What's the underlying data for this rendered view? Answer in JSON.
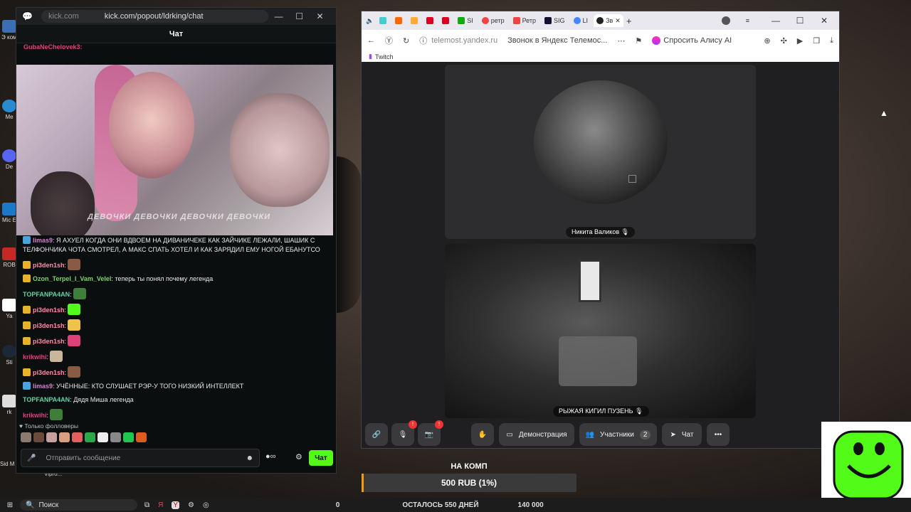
{
  "desktop": {
    "icons": [
      "Э комп",
      "Me",
      "De",
      "Mic E",
      "ROB",
      "Ya",
      "Sti",
      "rk",
      "Sid M Civilization VI"
    ],
    "taskbar_label": "Vipro..."
  },
  "kick_window": {
    "url_host": "kick.com",
    "url_path": "kick.com/popout/ldrking/chat",
    "chat_title": "Чат",
    "pinned_user": "GubaNeChelovek3:",
    "video_caption": "ДЕВОЧКИ ДЕВОЧКИ ДЕВОЧКИ ДЕВОЧКИ",
    "messages": [
      {
        "user": "limas9",
        "text": ": Я АХУЕЛ КОГДА ОНИ ВДВОЕМ НА ДИВАНИЧЕКЕ КАК ЗАЙЧИКЕ ЛЕЖАЛИ, ШАШИК С ТЕЛФОНЧИКА ЧОТА СМОТРЕЛ, А МАКС СПАТЬ ХОТЕЛ И КАК ЗАРЯДИЛ ЕМУ НОГОЙ ЕБАНУТСО",
        "user_color": "#d47fd0",
        "badge": "#4aa3df",
        "emote": ""
      },
      {
        "user": "pi3den1sh",
        "text": ":",
        "user_color": "#ff8aa8",
        "badge": "#e8b12a",
        "emote": "#8a5a44"
      },
      {
        "user": "Ozon_Terpel_I_Vam_Velel",
        "text": ": теперь ты понял почему легенда",
        "user_color": "#7cd36a",
        "badge": "#e8b12a",
        "emote": ""
      },
      {
        "user": "TOPFANPA4AN",
        "text": ":",
        "user_color": "#5fd3a8",
        "badge": "",
        "emote": "#3f7d3a"
      },
      {
        "user": "pi3den1sh",
        "text": ":",
        "user_color": "#ff8aa8",
        "badge": "#e8b12a",
        "emote": "#53fc18"
      },
      {
        "user": "pi3den1sh",
        "text": ":",
        "user_color": "#ff8aa8",
        "badge": "#e8b12a",
        "emote": "#f1c24a"
      },
      {
        "user": "pi3den1sh",
        "text": ":",
        "user_color": "#ff8aa8",
        "badge": "#e8b12a",
        "emote": "#e0407a"
      },
      {
        "user": "krikwihi",
        "text": ":",
        "user_color": "#e04080",
        "badge": "",
        "emote": "#c9b79a"
      },
      {
        "user": "pi3den1sh",
        "text": ":",
        "user_color": "#ff8aa8",
        "badge": "#e8b12a",
        "emote": "#8a5a44"
      },
      {
        "user": "limas9",
        "text": ": УЧЁННЫЕ: КТО СЛУШАЕТ РЭР-У ТОГО НИЗКИЙ ИНТЕЛЛЕКТ",
        "user_color": "#d47fd0",
        "badge": "#4aa3df",
        "emote": ""
      },
      {
        "user": "TOPFANPA4AN",
        "text": ": Дядя Миша легенда",
        "user_color": "#5fd3a8",
        "badge": "",
        "emote": ""
      },
      {
        "user": "krikwihi",
        "text": ":",
        "user_color": "#e04080",
        "badge": "",
        "emote": "#3f7d3a"
      }
    ],
    "followers_only": "Только фолловеры",
    "input_placeholder": "Отправить сообщение",
    "chat_button": "Чат"
  },
  "yandex_window": {
    "tabs": [
      "SI",
      "ретр",
      "Ретр",
      "SIG",
      "LI",
      "Зв"
    ],
    "url_host": "telemost.yandex.ru",
    "page_title": "Звонок в Яндекс Телемос...",
    "alice_button": "Спросить Алису AI",
    "bookmark": "Twitch",
    "participants": [
      {
        "name": "Никита Валиков"
      },
      {
        "name": "РЫЖАЯ КИГИЛ ПУЗЕНЬ"
      }
    ],
    "controls": {
      "demo": "Демонстрация",
      "participants": "Участники",
      "participants_count": "2",
      "chat": "Чат"
    },
    "mic_alert": "!",
    "cam_alert": "!"
  },
  "donation": {
    "title": "НА КОМП",
    "amount": "500 RUB (1%)",
    "progress_fraction": 0.01,
    "min": "0",
    "remaining": "ОСТАЛОСЬ 550 ДНЕЙ",
    "goal": "140 000"
  },
  "taskbar": {
    "search": "Поиск"
  }
}
